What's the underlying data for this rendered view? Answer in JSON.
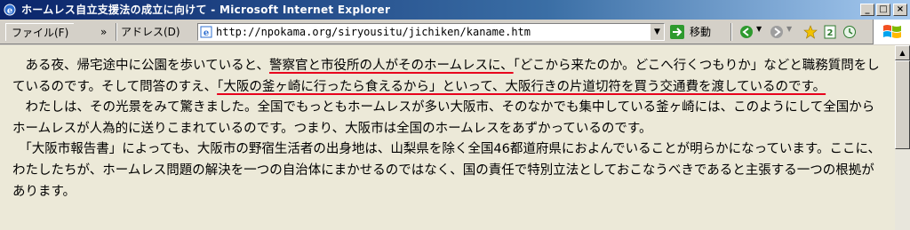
{
  "window": {
    "title": "ホームレス自立支援法の成立に向けて - Microsoft Internet Explorer",
    "buttons": {
      "minimize": "_",
      "maximize": "□",
      "close": "×"
    }
  },
  "toolbar": {
    "file_menu": "ファイル(F)",
    "overflow": "»",
    "address_label": "アドレス(D)",
    "url": "http://npokama.org/siryousitu/jichiken/kaname.htm",
    "dropdown": "▼",
    "go_label": "移動"
  },
  "content": {
    "p1": [
      {
        "text": "　ある夜、帰宅途中に公園を歩いていると、",
        "hl": false
      },
      {
        "text": "警察官と市役所の人がそのホームレスに、",
        "hl": true
      },
      {
        "text": "「どこから来たのか。どこへ行くつもりか」などと職務質問をしているのです。そして問答のすえ、",
        "hl": false
      },
      {
        "text": "「大阪の釜ヶ崎に行ったら食えるから」といって、大阪行きの片道切符を買う交通費を渡しているのです。",
        "hl": true
      }
    ],
    "p2": "　わたしは、その光景をみて驚きました。全国でもっともホームレスが多い大阪市、そのなかでも集中している釜ヶ崎には、このようにして全国からホームレスが人為的に送りこまれているのです。つまり、大阪市は全国のホームレスをあずかっているのです。",
    "p3": "　「大阪市報告書」によっても、大阪市の野宿生活者の出身地は、山梨県を除く全国46都道府県におよんでいることが明らかになっています。ここに、わたしたちが、ホームレス問題の解決を一つの自治体にまかせるのではなく、国の責任で特別立法としておこなうべきであると主張する一つの根拠があります。"
  },
  "colors": {
    "highlight_underline": "#e8001c",
    "title_bar": "#0a246a"
  },
  "icons": [
    "ie-icon",
    "page-icon",
    "go-arrow-icon",
    "back-icon",
    "forward-icon",
    "favorites-star-icon",
    "history-icon",
    "windows-logo-icon"
  ]
}
